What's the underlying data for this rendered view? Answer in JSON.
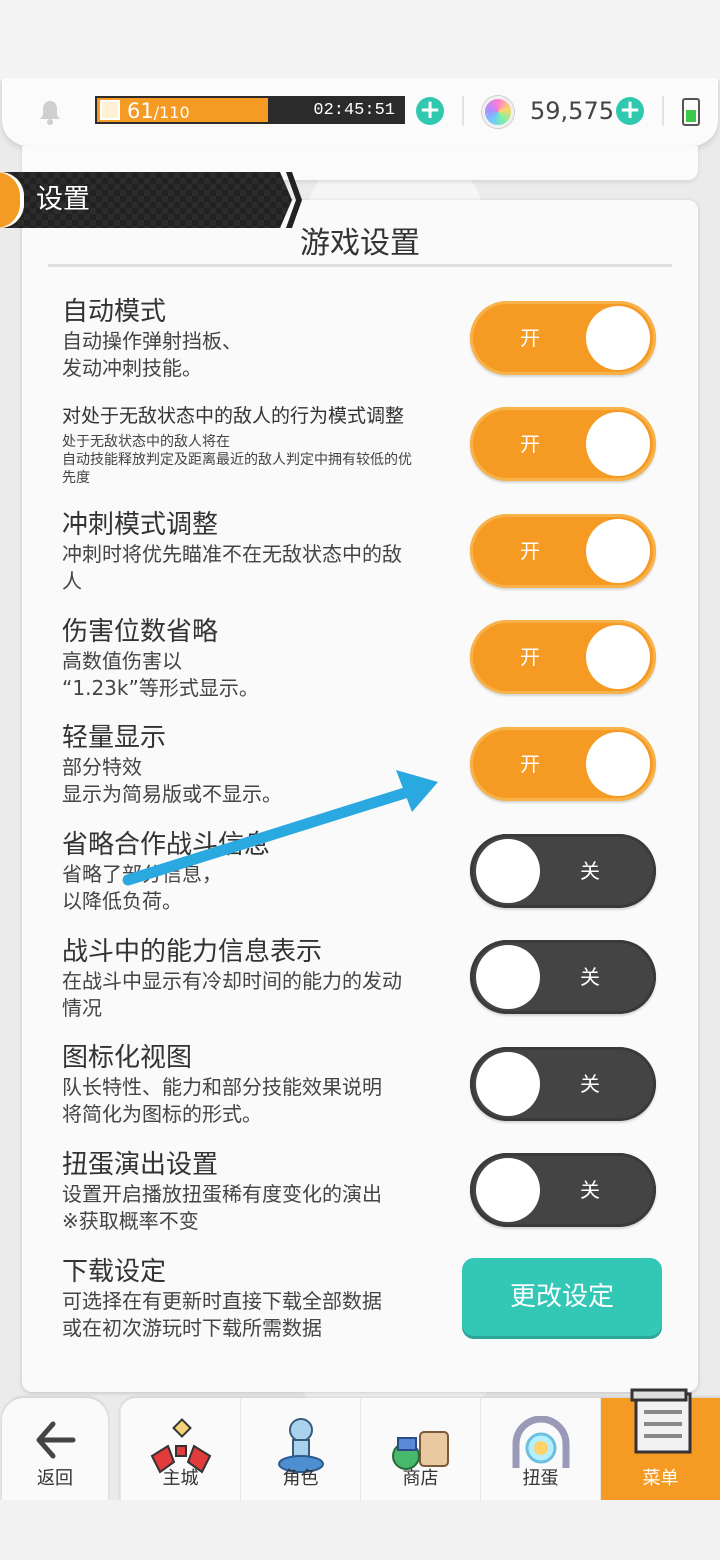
{
  "status_bar": {
    "stamina_current": "61",
    "stamina_max": "/110",
    "stamina_fraction": 0.555,
    "timer": "02:45:51",
    "gem_count": "59,575"
  },
  "section": {
    "label": "设置"
  },
  "panel": {
    "title": "游戏设置"
  },
  "settings": [
    {
      "title": "自动模式",
      "desc1": "自动操作弹射挡板、",
      "desc2": "发动冲刺技能。",
      "state": "开"
    },
    {
      "title": "对处于无敌状态中的敌人的行为模式调整",
      "desc1": "处于无敌状态中的敌人将在",
      "desc2": "自动技能释放判定及距离最近的敌人判定中拥有较低的优",
      "desc3": "先度",
      "state": "开"
    },
    {
      "title": "冲刺模式调整",
      "desc1": "冲刺时将优先瞄准不在无敌状态中的敌",
      "desc2": "人",
      "state": "开"
    },
    {
      "title": "伤害位数省略",
      "desc1": "高数值伤害以",
      "desc2": "“1.23k”等形式显示。",
      "state": "开"
    },
    {
      "title": "轻量显示",
      "desc1": "部分特效",
      "desc2": "显示为简易版或不显示。",
      "state": "开"
    },
    {
      "title": "省略合作战斗信息",
      "desc1": "省略了部分信息，",
      "desc2": "以降低负荷。",
      "state": "关"
    },
    {
      "title": "战斗中的能力信息表示",
      "desc1": "在战斗中显示有冷却时间的能力的发动",
      "desc2": "情况",
      "state": "关"
    },
    {
      "title": "图标化视图",
      "desc1": "队长特性、能力和部分技能效果说明",
      "desc2": "将简化为图标的形式。",
      "state": "关"
    },
    {
      "title": "扭蛋演出设置",
      "desc1": "设置开启播放扭蛋稀有度变化的演出",
      "desc2": "※获取概率不变",
      "state": "关"
    },
    {
      "title": "下载设定",
      "desc1": "可选择在有更新时直接下载全部数据",
      "desc2": "或在初次游玩时下载所需数据",
      "button": "更改设定"
    }
  ],
  "nav": {
    "back": "返回",
    "items": [
      "主城",
      "角色",
      "商店",
      "扭蛋",
      "菜单"
    ],
    "active": "菜单"
  },
  "colors": {
    "accent": "#f59a23",
    "teal": "#33c7b6",
    "dark": "#444444",
    "arrow": "#2aa8e0"
  }
}
